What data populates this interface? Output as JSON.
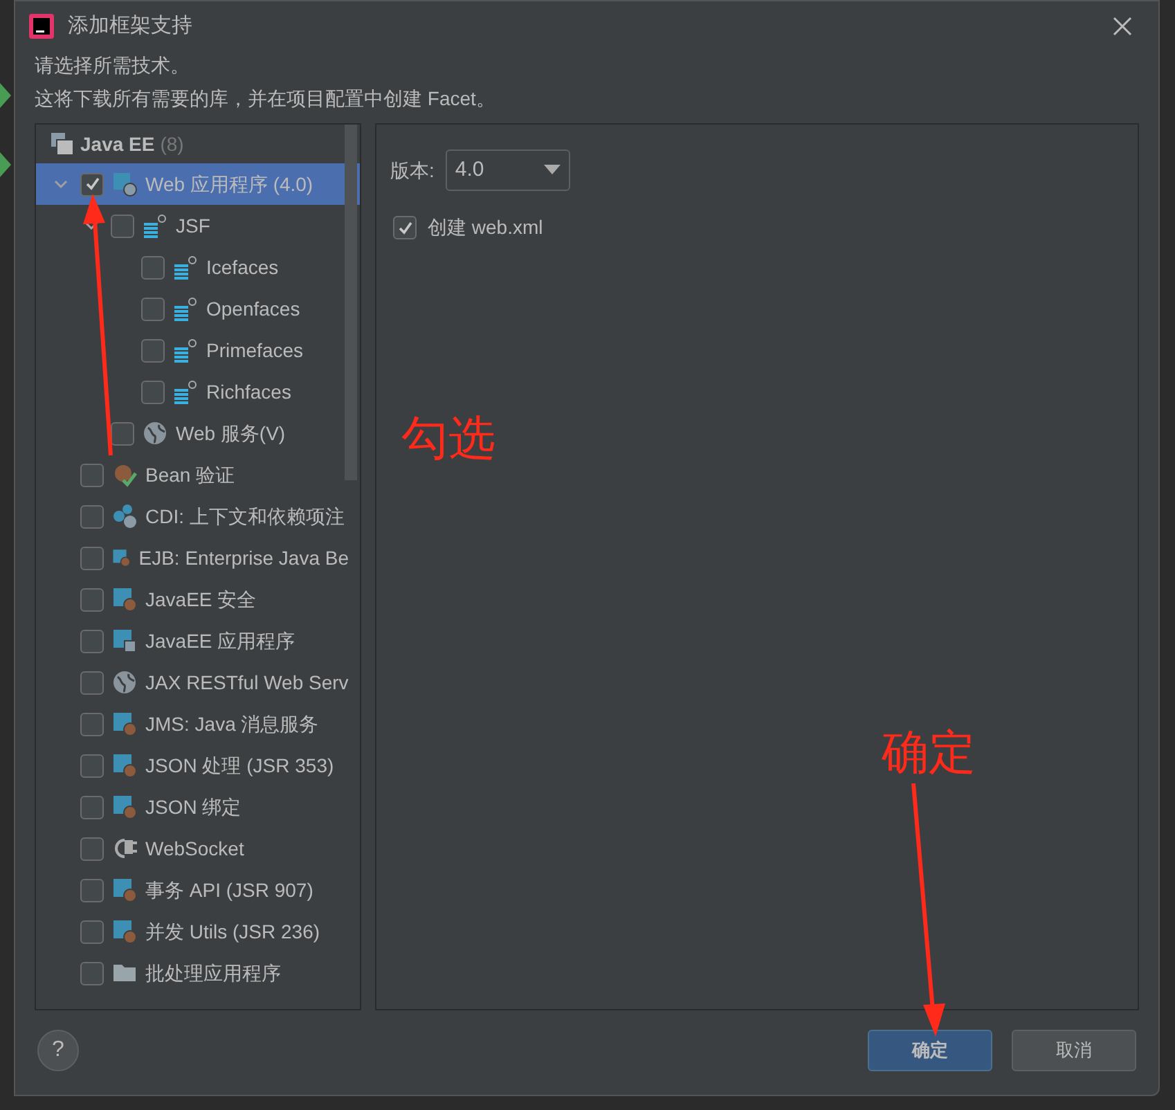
{
  "window": {
    "title": "添加框架支持"
  },
  "intro": [
    "请选择所需技术。",
    "这将下载所有需要的库，并在项目配置中创建 Facet。"
  ],
  "tree": {
    "group": {
      "label": "Java EE",
      "count": "(8)"
    },
    "items": [
      {
        "label": "Web 应用程序 (4.0)",
        "kind": "webapp",
        "checked": true,
        "selected": true,
        "expanded": true,
        "children": [
          {
            "label": "JSF",
            "kind": "jsf",
            "checked": false,
            "selected": false,
            "expanded": true,
            "children": [
              {
                "label": "Icefaces",
                "kind": "jsf",
                "checked": false,
                "selected": false
              },
              {
                "label": "Openfaces",
                "kind": "jsf",
                "checked": false,
                "selected": false
              },
              {
                "label": "Primefaces",
                "kind": "jsf",
                "checked": false,
                "selected": false
              },
              {
                "label": "Richfaces",
                "kind": "jsf",
                "checked": false,
                "selected": false
              }
            ]
          },
          {
            "label": "Web 服务(V)",
            "kind": "globe",
            "checked": false,
            "selected": false
          }
        ]
      },
      {
        "label": "Bean 验证",
        "kind": "bean",
        "checked": false,
        "selected": false
      },
      {
        "label": "CDI: 上下文和依赖项注",
        "kind": "cdi",
        "checked": false,
        "selected": false
      },
      {
        "label": "EJB: Enterprise Java Be",
        "kind": "module",
        "checked": false,
        "selected": false
      },
      {
        "label": "JavaEE 安全",
        "kind": "module",
        "checked": false,
        "selected": false
      },
      {
        "label": "JavaEE 应用程序",
        "kind": "app",
        "checked": false,
        "selected": false
      },
      {
        "label": "JAX RESTful Web Serv",
        "kind": "globe",
        "checked": false,
        "selected": false
      },
      {
        "label": "JMS: Java 消息服务",
        "kind": "module",
        "checked": false,
        "selected": false
      },
      {
        "label": "JSON 处理 (JSR 353)",
        "kind": "module",
        "checked": false,
        "selected": false
      },
      {
        "label": "JSON 绑定",
        "kind": "module",
        "checked": false,
        "selected": false
      },
      {
        "label": "WebSocket",
        "kind": "socket",
        "checked": false,
        "selected": false
      },
      {
        "label": "事务 API (JSR 907)",
        "kind": "module",
        "checked": false,
        "selected": false
      },
      {
        "label": "并发 Utils (JSR 236)",
        "kind": "module",
        "checked": false,
        "selected": false
      },
      {
        "label": "批处理应用程序",
        "kind": "folder",
        "checked": false,
        "selected": false
      }
    ]
  },
  "settings": {
    "version_label": "版本:",
    "version_value": "4.0",
    "create_xml": {
      "label": "创建 web.xml",
      "checked": true
    }
  },
  "buttons": [
    {
      "label": "确定",
      "selected": true
    },
    {
      "label": "取消",
      "selected": false
    }
  ],
  "help": "?",
  "annotations": [
    {
      "text": "勾选",
      "kind": "up"
    },
    {
      "text": "确定",
      "kind": "down"
    }
  ]
}
